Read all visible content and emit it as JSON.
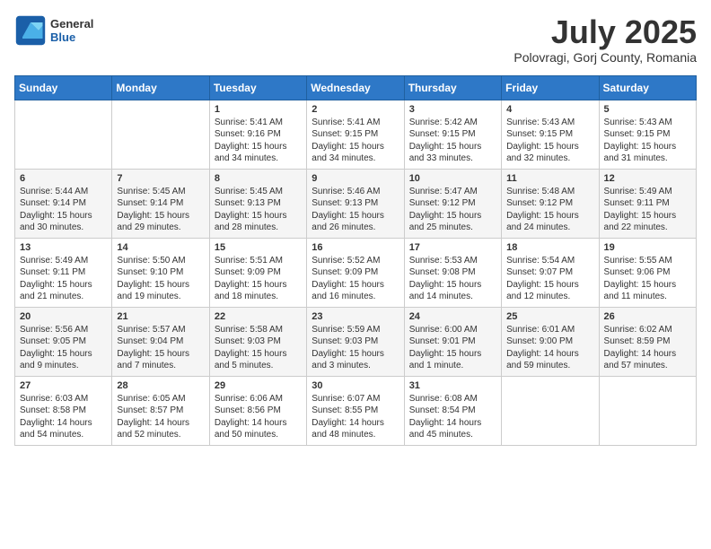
{
  "header": {
    "logo": {
      "general": "General",
      "blue": "Blue"
    },
    "title": "July 2025",
    "location": "Polovragi, Gorj County, Romania"
  },
  "calendar": {
    "weekdays": [
      "Sunday",
      "Monday",
      "Tuesday",
      "Wednesday",
      "Thursday",
      "Friday",
      "Saturday"
    ],
    "weeks": [
      [
        {
          "day": "",
          "info": ""
        },
        {
          "day": "",
          "info": ""
        },
        {
          "day": "1",
          "info": "Sunrise: 5:41 AM\nSunset: 9:16 PM\nDaylight: 15 hours\nand 34 minutes."
        },
        {
          "day": "2",
          "info": "Sunrise: 5:41 AM\nSunset: 9:15 PM\nDaylight: 15 hours\nand 34 minutes."
        },
        {
          "day": "3",
          "info": "Sunrise: 5:42 AM\nSunset: 9:15 PM\nDaylight: 15 hours\nand 33 minutes."
        },
        {
          "day": "4",
          "info": "Sunrise: 5:43 AM\nSunset: 9:15 PM\nDaylight: 15 hours\nand 32 minutes."
        },
        {
          "day": "5",
          "info": "Sunrise: 5:43 AM\nSunset: 9:15 PM\nDaylight: 15 hours\nand 31 minutes."
        }
      ],
      [
        {
          "day": "6",
          "info": "Sunrise: 5:44 AM\nSunset: 9:14 PM\nDaylight: 15 hours\nand 30 minutes."
        },
        {
          "day": "7",
          "info": "Sunrise: 5:45 AM\nSunset: 9:14 PM\nDaylight: 15 hours\nand 29 minutes."
        },
        {
          "day": "8",
          "info": "Sunrise: 5:45 AM\nSunset: 9:13 PM\nDaylight: 15 hours\nand 28 minutes."
        },
        {
          "day": "9",
          "info": "Sunrise: 5:46 AM\nSunset: 9:13 PM\nDaylight: 15 hours\nand 26 minutes."
        },
        {
          "day": "10",
          "info": "Sunrise: 5:47 AM\nSunset: 9:12 PM\nDaylight: 15 hours\nand 25 minutes."
        },
        {
          "day": "11",
          "info": "Sunrise: 5:48 AM\nSunset: 9:12 PM\nDaylight: 15 hours\nand 24 minutes."
        },
        {
          "day": "12",
          "info": "Sunrise: 5:49 AM\nSunset: 9:11 PM\nDaylight: 15 hours\nand 22 minutes."
        }
      ],
      [
        {
          "day": "13",
          "info": "Sunrise: 5:49 AM\nSunset: 9:11 PM\nDaylight: 15 hours\nand 21 minutes."
        },
        {
          "day": "14",
          "info": "Sunrise: 5:50 AM\nSunset: 9:10 PM\nDaylight: 15 hours\nand 19 minutes."
        },
        {
          "day": "15",
          "info": "Sunrise: 5:51 AM\nSunset: 9:09 PM\nDaylight: 15 hours\nand 18 minutes."
        },
        {
          "day": "16",
          "info": "Sunrise: 5:52 AM\nSunset: 9:09 PM\nDaylight: 15 hours\nand 16 minutes."
        },
        {
          "day": "17",
          "info": "Sunrise: 5:53 AM\nSunset: 9:08 PM\nDaylight: 15 hours\nand 14 minutes."
        },
        {
          "day": "18",
          "info": "Sunrise: 5:54 AM\nSunset: 9:07 PM\nDaylight: 15 hours\nand 12 minutes."
        },
        {
          "day": "19",
          "info": "Sunrise: 5:55 AM\nSunset: 9:06 PM\nDaylight: 15 hours\nand 11 minutes."
        }
      ],
      [
        {
          "day": "20",
          "info": "Sunrise: 5:56 AM\nSunset: 9:05 PM\nDaylight: 15 hours\nand 9 minutes."
        },
        {
          "day": "21",
          "info": "Sunrise: 5:57 AM\nSunset: 9:04 PM\nDaylight: 15 hours\nand 7 minutes."
        },
        {
          "day": "22",
          "info": "Sunrise: 5:58 AM\nSunset: 9:03 PM\nDaylight: 15 hours\nand 5 minutes."
        },
        {
          "day": "23",
          "info": "Sunrise: 5:59 AM\nSunset: 9:03 PM\nDaylight: 15 hours\nand 3 minutes."
        },
        {
          "day": "24",
          "info": "Sunrise: 6:00 AM\nSunset: 9:01 PM\nDaylight: 15 hours\nand 1 minute."
        },
        {
          "day": "25",
          "info": "Sunrise: 6:01 AM\nSunset: 9:00 PM\nDaylight: 14 hours\nand 59 minutes."
        },
        {
          "day": "26",
          "info": "Sunrise: 6:02 AM\nSunset: 8:59 PM\nDaylight: 14 hours\nand 57 minutes."
        }
      ],
      [
        {
          "day": "27",
          "info": "Sunrise: 6:03 AM\nSunset: 8:58 PM\nDaylight: 14 hours\nand 54 minutes."
        },
        {
          "day": "28",
          "info": "Sunrise: 6:05 AM\nSunset: 8:57 PM\nDaylight: 14 hours\nand 52 minutes."
        },
        {
          "day": "29",
          "info": "Sunrise: 6:06 AM\nSunset: 8:56 PM\nDaylight: 14 hours\nand 50 minutes."
        },
        {
          "day": "30",
          "info": "Sunrise: 6:07 AM\nSunset: 8:55 PM\nDaylight: 14 hours\nand 48 minutes."
        },
        {
          "day": "31",
          "info": "Sunrise: 6:08 AM\nSunset: 8:54 PM\nDaylight: 14 hours\nand 45 minutes."
        },
        {
          "day": "",
          "info": ""
        },
        {
          "day": "",
          "info": ""
        }
      ]
    ]
  }
}
